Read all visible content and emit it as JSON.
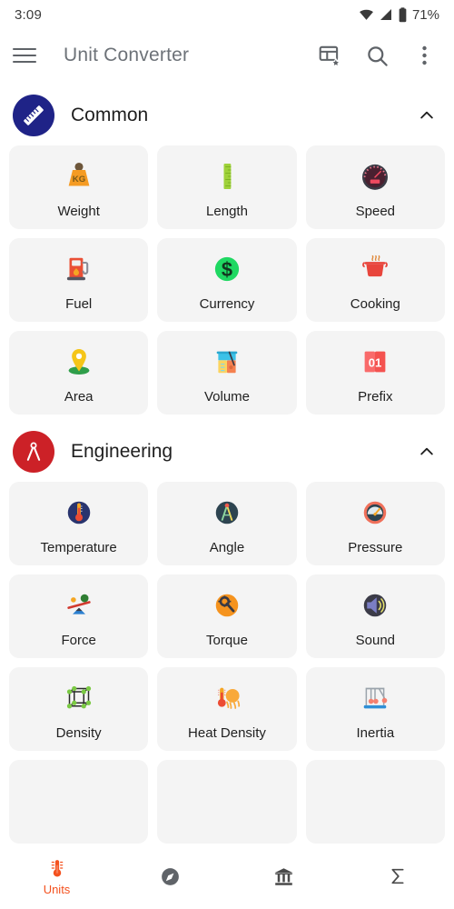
{
  "status_bar": {
    "time": "3:09",
    "battery": "71%",
    "icons": [
      "wifi-icon",
      "signal-icon",
      "battery-icon"
    ]
  },
  "app_bar": {
    "menu_icon": "hamburger-menu-icon",
    "title": "Unit Converter",
    "actions": [
      {
        "name": "customize-grid-icon",
        "label": "Customize grid"
      },
      {
        "name": "search-icon",
        "label": "Search"
      },
      {
        "name": "overflow-menu-icon",
        "label": "More options"
      }
    ]
  },
  "colors": {
    "accent": "#f4511e",
    "common_badge": "#1f2387",
    "engineering_badge": "#cc2127",
    "tile_bg": "#f4f4f4",
    "title_gray": "#6d7278"
  },
  "sections": [
    {
      "id": "common",
      "title": "Common",
      "badge_icon": "ruler-icon",
      "badge_color": "#1f2387",
      "expanded": true,
      "chevron": "chevron-up-icon",
      "tiles": [
        {
          "label": "Weight",
          "icon": "kg-weight-icon"
        },
        {
          "label": "Length",
          "icon": "ruler-green-icon"
        },
        {
          "label": "Speed",
          "icon": "speedometer-icon"
        },
        {
          "label": "Fuel",
          "icon": "fuel-pump-icon"
        },
        {
          "label": "Currency",
          "icon": "dollar-coin-icon"
        },
        {
          "label": "Cooking",
          "icon": "cooking-pot-icon"
        },
        {
          "label": "Area",
          "icon": "map-pin-icon"
        },
        {
          "label": "Volume",
          "icon": "beaker-icon"
        },
        {
          "label": "Prefix",
          "icon": "digits-01-icon"
        }
      ]
    },
    {
      "id": "engineering",
      "title": "Engineering",
      "badge_icon": "compass-divider-icon",
      "badge_color": "#cc2127",
      "expanded": true,
      "chevron": "chevron-up-icon",
      "tiles": [
        {
          "label": "Temperature",
          "icon": "thermometer-night-icon"
        },
        {
          "label": "Angle",
          "icon": "divider-compass-icon"
        },
        {
          "label": "Pressure",
          "icon": "pressure-gauge-icon"
        },
        {
          "label": "Force",
          "icon": "seesaw-balance-icon"
        },
        {
          "label": "Torque",
          "icon": "wrench-gear-icon"
        },
        {
          "label": "Sound",
          "icon": "speaker-icon"
        },
        {
          "label": "Density",
          "icon": "cube-lattice-icon"
        },
        {
          "label": "Heat Density",
          "icon": "thermometer-sun-icon"
        },
        {
          "label": "Inertia",
          "icon": "newtons-cradle-icon"
        }
      ]
    }
  ],
  "bottom_nav": [
    {
      "id": "units",
      "label": "Units",
      "icon": "thermometer-icon",
      "active": true
    },
    {
      "id": "tools",
      "label": "",
      "icon": "compass-icon",
      "active": false
    },
    {
      "id": "finance",
      "label": "",
      "icon": "bank-icon",
      "active": false
    },
    {
      "id": "calculator",
      "label": "",
      "icon": "sigma-icon",
      "active": false
    }
  ]
}
